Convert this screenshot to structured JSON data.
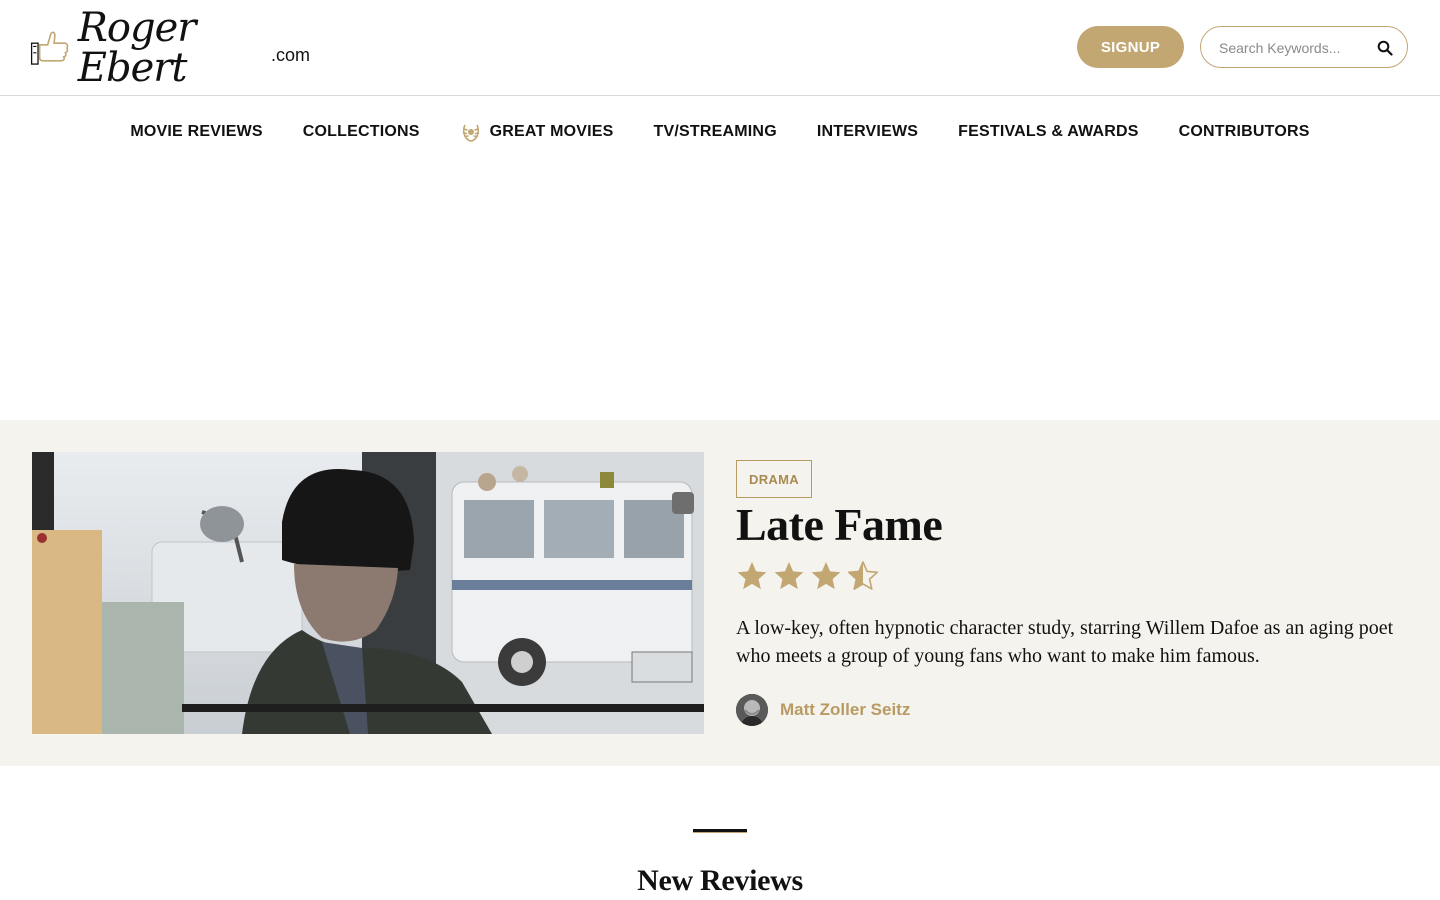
{
  "header": {
    "logo": {
      "name": "Roger Ebert",
      "suffix": ".com"
    },
    "signup_label": "SIGNUP",
    "search": {
      "placeholder": "Search Keywords..."
    }
  },
  "nav": {
    "items": [
      {
        "label": "MOVIE REVIEWS"
      },
      {
        "label": "COLLECTIONS"
      },
      {
        "label": "GREAT MOVIES",
        "icon": "laurel-icon"
      },
      {
        "label": "TV/STREAMING"
      },
      {
        "label": "INTERVIEWS"
      },
      {
        "label": "FESTIVALS & AWARDS"
      },
      {
        "label": "CONTRIBUTORS"
      }
    ]
  },
  "featured": {
    "genre": "DRAMA",
    "title": "Late Fame",
    "rating": 3.5,
    "rating_max": 4,
    "blurb": "A low-key, often hypnotic character study, starring Willem Dafoe as an aging poet who meets a group of young fans who want to make him famous.",
    "author": "Matt Zoller Seitz"
  },
  "new_reviews": {
    "title": "New Reviews"
  },
  "colors": {
    "accent": "#c2a773",
    "accent_text": "#b89a63",
    "featured_bg": "#f5f3ee"
  }
}
